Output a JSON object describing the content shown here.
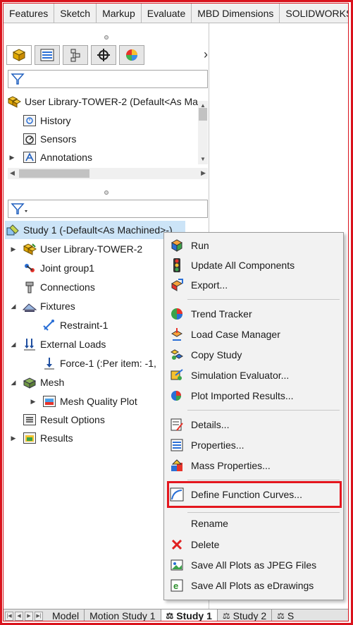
{
  "command_tabs": [
    "Features",
    "Sketch",
    "Markup",
    "Evaluate",
    "MBD Dimensions",
    "SOLIDWORKS"
  ],
  "feature_tree": {
    "root": "User Library-TOWER-2 (Default<As Ma",
    "items": [
      "History",
      "Sensors",
      "Annotations"
    ]
  },
  "sim_tree": {
    "study": "Study 1 (-Default<As Machined>-)",
    "items": [
      {
        "label": "User Library-TOWER-2"
      },
      {
        "label": "Joint group1"
      },
      {
        "label": "Connections"
      },
      {
        "label": "Fixtures"
      },
      {
        "label": "Restraint-1"
      },
      {
        "label": "External Loads"
      },
      {
        "label": "Force-1 (:Per item: -1,"
      },
      {
        "label": "Mesh"
      },
      {
        "label": "Mesh Quality Plot"
      },
      {
        "label": "Result Options"
      },
      {
        "label": "Results"
      }
    ]
  },
  "context_menu": {
    "items": [
      {
        "label": "Run",
        "icon": "run-icon"
      },
      {
        "label": "Update All Components",
        "icon": "traffic-light-icon"
      },
      {
        "label": "Export...",
        "icon": "export-icon"
      },
      {
        "label": "Trend Tracker",
        "icon": "trend-tracker-icon"
      },
      {
        "label": "Load Case Manager",
        "icon": "load-case-icon"
      },
      {
        "label": "Copy Study",
        "icon": "copy-study-icon"
      },
      {
        "label": "Simulation Evaluator...",
        "icon": "evaluator-icon"
      },
      {
        "label": "Plot Imported Results...",
        "icon": "plot-import-icon"
      },
      {
        "label": "Details...",
        "icon": "details-icon"
      },
      {
        "label": "Properties...",
        "icon": "properties-icon"
      },
      {
        "label": "Mass Properties...",
        "icon": "mass-properties-icon"
      },
      {
        "label": "Define Function Curves...",
        "icon": "function-curve-icon"
      },
      {
        "label": "Rename",
        "icon": ""
      },
      {
        "label": "Delete",
        "icon": "delete-icon"
      },
      {
        "label": "Save All Plots as JPEG Files",
        "icon": "jpeg-icon"
      },
      {
        "label": "Save All Plots as eDrawings",
        "icon": "edrawings-icon"
      }
    ]
  },
  "bottom_tabs": [
    "Model",
    "Motion Study 1",
    "Study 1",
    "Study 2",
    "S"
  ],
  "colors": {
    "highlight": "#e4161e",
    "frame": "#d9121c",
    "selection": "#cce4f7"
  }
}
